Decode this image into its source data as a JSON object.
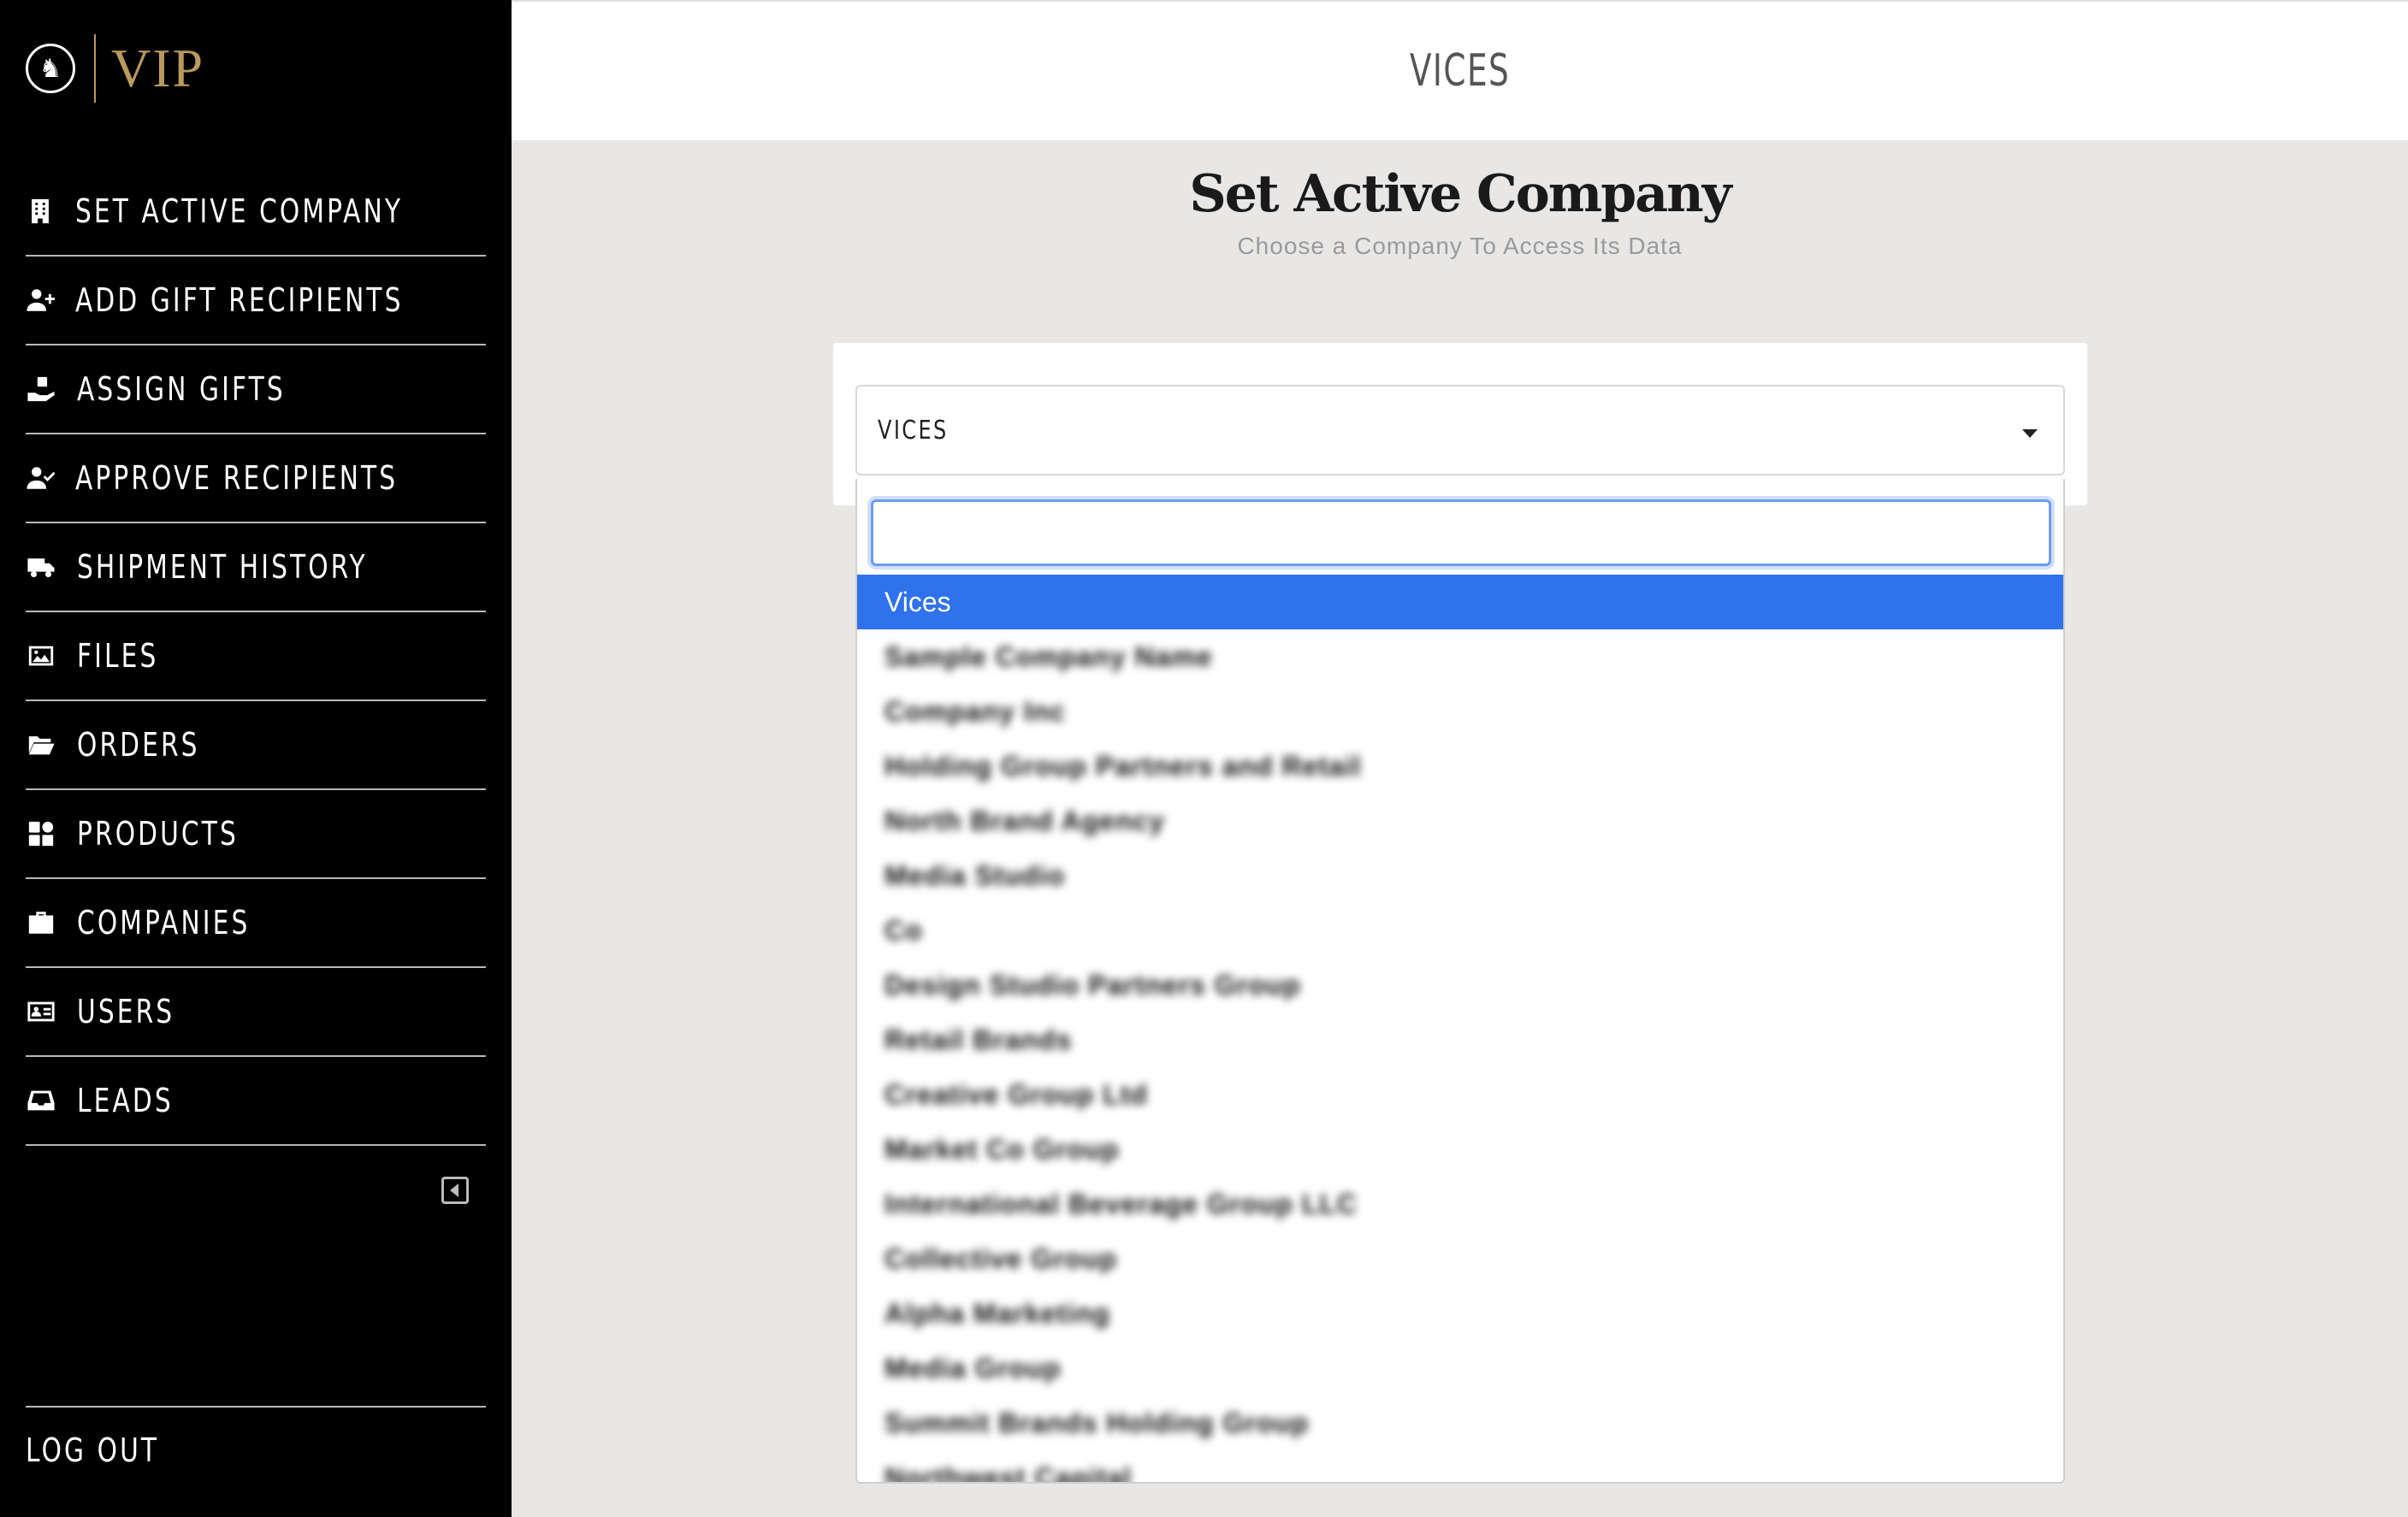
{
  "logo": {
    "text": "VIP",
    "mark": "♞"
  },
  "sidebar": {
    "items": [
      {
        "label": "SET ACTIVE COMPANY",
        "icon": "building-icon"
      },
      {
        "label": "ADD GIFT RECIPIENTS",
        "icon": "user-plus-icon"
      },
      {
        "label": "ASSIGN GIFTS",
        "icon": "hand-gift-icon"
      },
      {
        "label": "APPROVE RECIPIENTS",
        "icon": "user-check-icon"
      },
      {
        "label": "SHIPMENT HISTORY",
        "icon": "truck-icon"
      },
      {
        "label": "FILES",
        "icon": "image-icon"
      },
      {
        "label": "ORDERS",
        "icon": "folder-open-icon"
      },
      {
        "label": "PRODUCTS",
        "icon": "products-icon"
      },
      {
        "label": "COMPANIES",
        "icon": "briefcase-icon"
      },
      {
        "label": "USERS",
        "icon": "id-card-icon"
      },
      {
        "label": "LEADS",
        "icon": "inbox-icon"
      }
    ],
    "logout_label": "LOG OUT"
  },
  "header": {
    "title": "VICES"
  },
  "main": {
    "title": "Set Active Company",
    "subtitle": "Choose a Company To Access Its Data"
  },
  "company_select": {
    "value": "VICES",
    "search_placeholder": "",
    "options": [
      {
        "label": "Vices",
        "selected": true
      },
      {
        "label": "Sample Company Name"
      },
      {
        "label": "Company Inc"
      },
      {
        "label": "Holding Group Partners and Retail"
      },
      {
        "label": "North Brand Agency"
      },
      {
        "label": "Media Studio"
      },
      {
        "label": "Co"
      },
      {
        "label": "Design Studio Partners Group"
      },
      {
        "label": "Retail Brands"
      },
      {
        "label": "Creative Group Ltd"
      },
      {
        "label": "Market Co Group"
      },
      {
        "label": "International Beverage Group LLC"
      },
      {
        "label": "Collective Group"
      },
      {
        "label": "Alpha Marketing"
      },
      {
        "label": "Media Group"
      },
      {
        "label": "Summit Brands Holding Group"
      },
      {
        "label": "Northwest Capital"
      }
    ]
  }
}
